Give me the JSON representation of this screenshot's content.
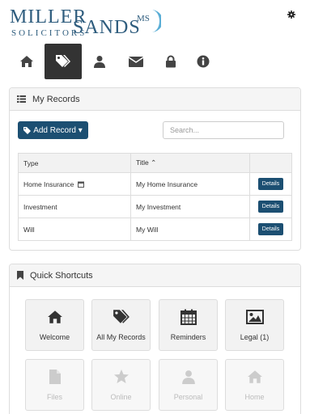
{
  "logo": {
    "line1": "MILLER",
    "line2": "SOLICITORS",
    "line3": "SANDS",
    "mark": "MS"
  },
  "header": {
    "settings_icon": "gear-icon"
  },
  "nav": {
    "items": [
      {
        "icon": "home-icon"
      },
      {
        "icon": "tags-icon",
        "active": true
      },
      {
        "icon": "user-icon"
      },
      {
        "icon": "envelope-icon"
      },
      {
        "icon": "lock-icon"
      },
      {
        "icon": "info-icon"
      }
    ]
  },
  "records": {
    "heading": "My Records",
    "add_button": "Add Record ▾",
    "search_placeholder": "Search...",
    "columns": [
      "Type",
      "Title ⌃",
      ""
    ],
    "rows": [
      {
        "type": "Home Insurance",
        "title": "My Home Insurance",
        "action": "Details",
        "has_calendar_icon": true
      },
      {
        "type": "Investment",
        "title": "My Investment",
        "action": "Details"
      },
      {
        "type": "Will",
        "title": "My Will",
        "action": "Details"
      }
    ]
  },
  "shortcuts": {
    "heading": "Quick Shortcuts",
    "tiles": [
      {
        "label": "Welcome",
        "icon": "home-icon",
        "enabled": true
      },
      {
        "label": "All My Records",
        "icon": "tags-icon",
        "enabled": true
      },
      {
        "label": "Reminders",
        "icon": "calendar-icon",
        "enabled": true
      },
      {
        "label": "Legal (1)",
        "icon": "picture-icon",
        "enabled": true
      },
      {
        "label": "Files",
        "icon": "file-icon",
        "enabled": false
      },
      {
        "label": "Online",
        "icon": "star-icon",
        "enabled": false
      },
      {
        "label": "Personal",
        "icon": "user-icon",
        "enabled": false
      },
      {
        "label": "Home",
        "icon": "home-icon",
        "enabled": false
      }
    ]
  },
  "colors": {
    "brand": "#2f5d7e",
    "button": "#1c4f72",
    "nav_active": "#333333"
  }
}
